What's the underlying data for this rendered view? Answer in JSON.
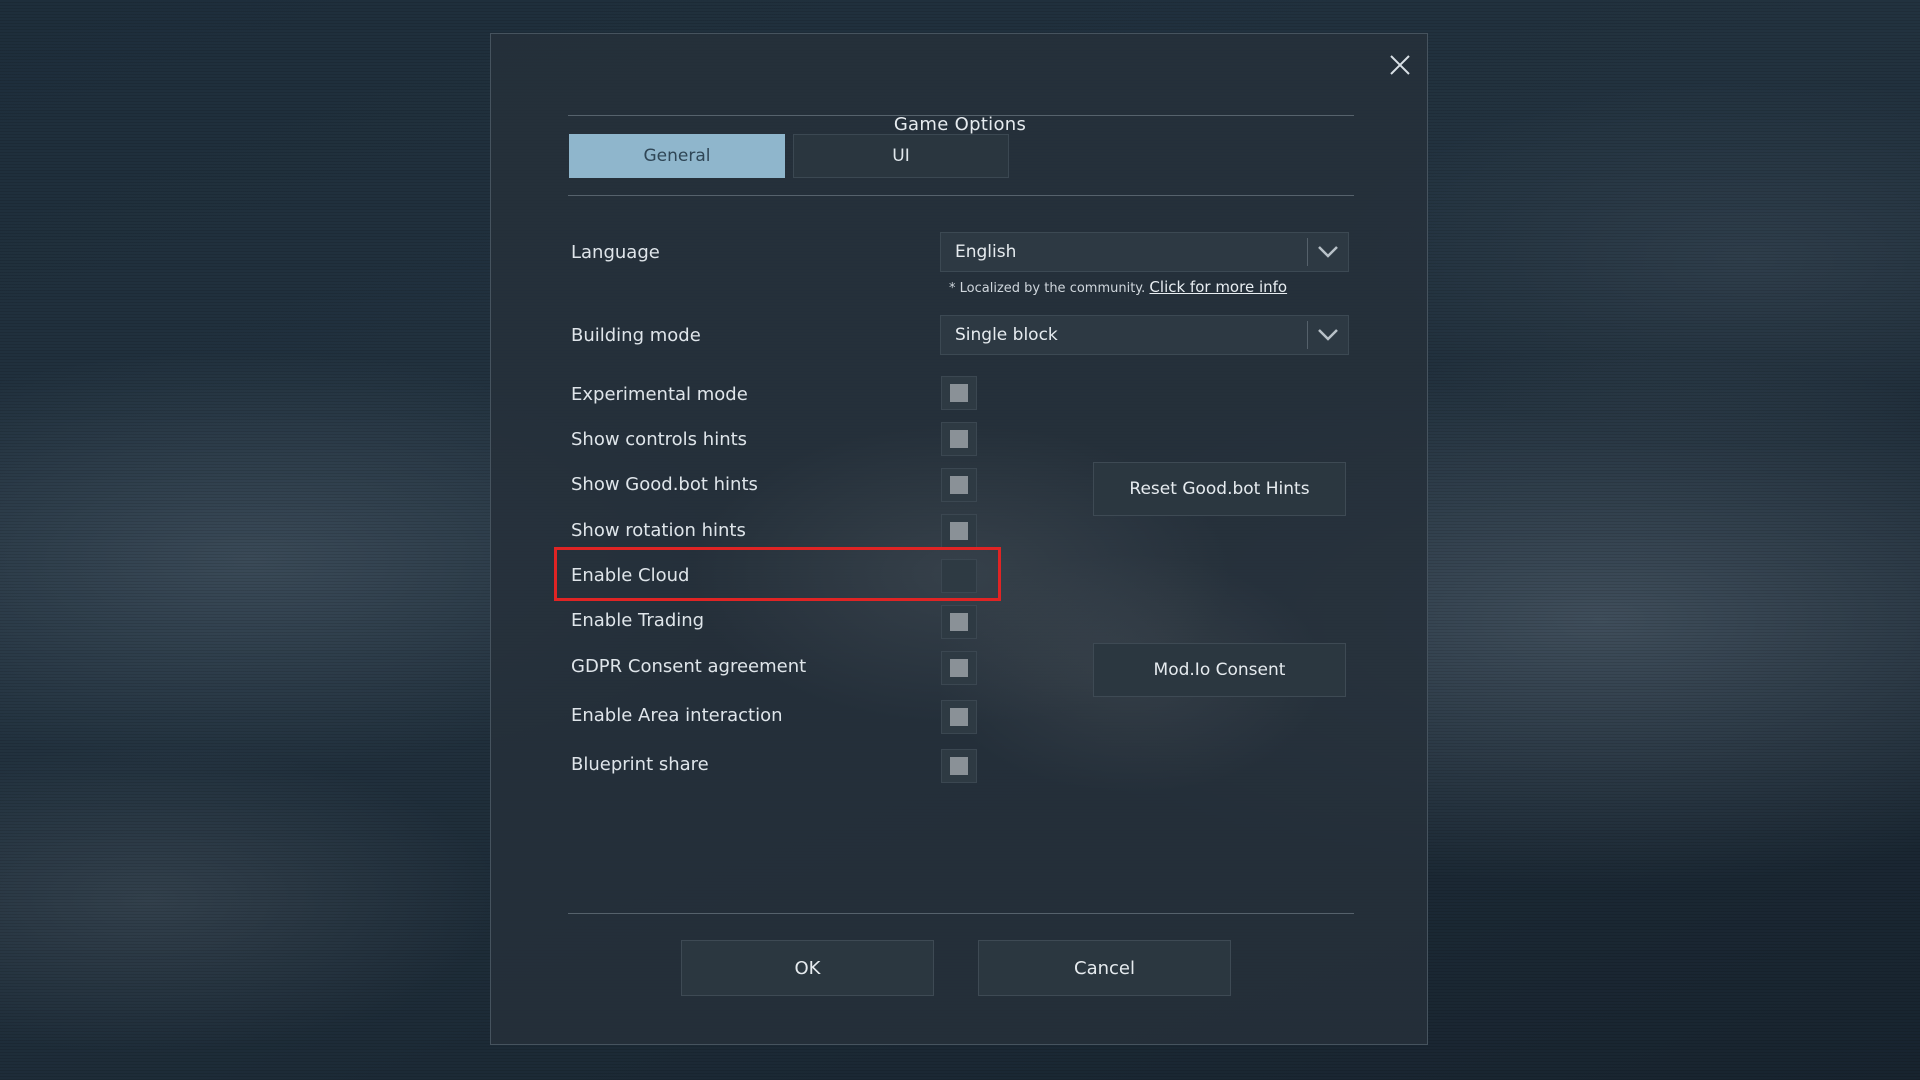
{
  "dialog": {
    "title": "Game Options",
    "close_icon": "close-icon"
  },
  "tabs": [
    {
      "label": "General",
      "active": true
    },
    {
      "label": "UI",
      "active": false
    }
  ],
  "language": {
    "label": "Language",
    "value": "English",
    "note": "* Localized by the community.",
    "link": "Click for more info"
  },
  "building_mode": {
    "label": "Building mode",
    "value": "Single block"
  },
  "options": [
    {
      "label": "Experimental mode",
      "checked": true
    },
    {
      "label": "Show controls hints",
      "checked": true
    },
    {
      "label": "Show Good.bot hints",
      "checked": true
    },
    {
      "label": "Show rotation hints",
      "checked": true
    },
    {
      "label": "Enable Cloud",
      "checked": false,
      "highlighted": true
    },
    {
      "label": "Enable Trading",
      "checked": true
    },
    {
      "label": "GDPR Consent agreement",
      "checked": true
    },
    {
      "label": "Enable Area interaction",
      "checked": true
    },
    {
      "label": "Blueprint share",
      "checked": true
    }
  ],
  "side_buttons": {
    "reset_hints": "Reset Good.bot Hints",
    "modio_consent": "Mod.Io Consent"
  },
  "footer": {
    "ok": "OK",
    "cancel": "Cancel"
  },
  "colors": {
    "active_tab": "#8fb6cc",
    "highlight": "#e02424",
    "dialog_bg": "#25303a"
  }
}
